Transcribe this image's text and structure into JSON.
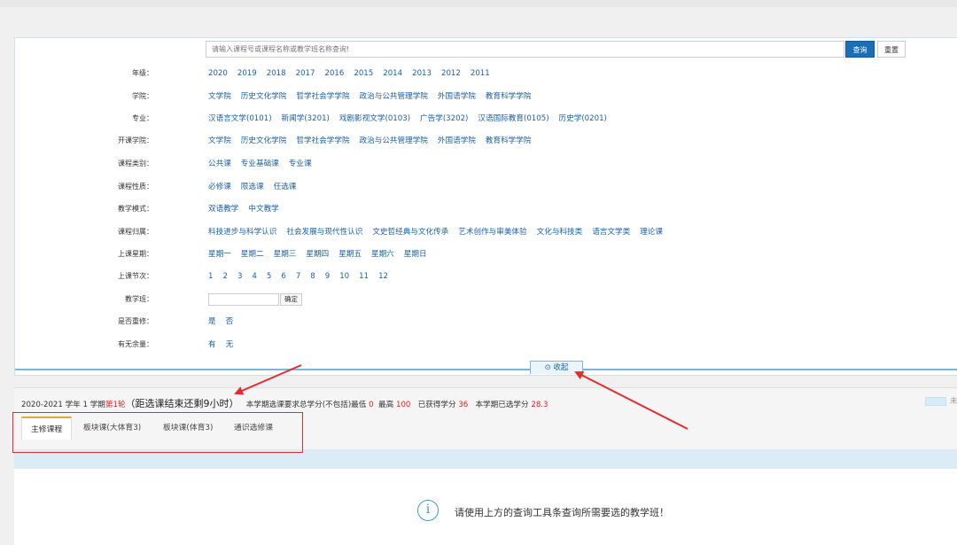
{
  "search": {
    "placeholder": "请输入课程号或课程名称或教学班名称查询!",
    "query_label": "查询",
    "reset_label": "重置"
  },
  "filters": [
    {
      "label": "年级：",
      "options": [
        "2020",
        "2019",
        "2018",
        "2017",
        "2016",
        "2015",
        "2014",
        "2013",
        "2012",
        "2011"
      ]
    },
    {
      "label": "学院：",
      "options": [
        "文学院",
        "历史文化学院",
        "哲学社会学学院",
        "政治与公共管理学院",
        "外国语学院",
        "教育科学学院"
      ]
    },
    {
      "label": "专业：",
      "options": [
        "汉语言文学(0101)",
        "新闻学(3201)",
        "戏剧影视文学(0103)",
        "广告学(3202)",
        "汉语国际教育(0105)",
        "历史学(0201)"
      ]
    },
    {
      "label": "开课学院：",
      "options": [
        "文学院",
        "历史文化学院",
        "哲学社会学学院",
        "政治与公共管理学院",
        "外国语学院",
        "教育科学学院"
      ]
    },
    {
      "label": "课程类别：",
      "options": [
        "公共课",
        "专业基础课",
        "专业课"
      ]
    },
    {
      "label": "课程性质：",
      "options": [
        "必修课",
        "限选课",
        "任选课"
      ]
    },
    {
      "label": "教学模式：",
      "options": [
        "双语教学",
        "中文教学"
      ]
    },
    {
      "label": "课程归属：",
      "options": [
        "科技进步与科学认识",
        "社会发展与现代性认识",
        "文史哲经典与文化传承",
        "艺术创作与审美体验",
        "文化与科技类",
        "语言文学类",
        "理论课"
      ]
    },
    {
      "label": "上课星期：",
      "options": [
        "星期一",
        "星期二",
        "星期三",
        "星期四",
        "星期五",
        "星期六",
        "星期日"
      ]
    },
    {
      "label": "上课节次：",
      "options": [
        "1",
        "2",
        "3",
        "4",
        "5",
        "6",
        "7",
        "8",
        "9",
        "10",
        "11",
        "12"
      ]
    },
    {
      "label": "教学班：",
      "input": true,
      "button": "确定"
    },
    {
      "label": "是否重修：",
      "options": [
        "是",
        "否"
      ]
    },
    {
      "label": "有无余量：",
      "options": [
        "有",
        "无"
      ]
    }
  ],
  "collapse_label": "收起",
  "status": {
    "year_term": "2020-2021 学年 1 学期",
    "round": "第1轮",
    "countdown": "（距选课结束还剩9小时）",
    "credits_text": "本学期选课要求总学分(不包括)最低",
    "min_credit": "0",
    "max_label": "最高",
    "max_credit": "100",
    "earned_label": "已获得学分",
    "earned_credit": "36",
    "selected_label": "本学期已选学分",
    "selected_credit": "28.3",
    "legend_label": "未"
  },
  "tabs": [
    "主修课程",
    "板块课(大体育3)",
    "板块课(体育3)",
    "通识选修课"
  ],
  "empty_message": "请使用上方的查询工具条查询所需要选的教学班！",
  "colors": {
    "primary": "#1a6fb8",
    "link": "#1a5fa8",
    "highlight": "#e02020",
    "annotation": "#e52b2b",
    "tab_accent": "#e8a63a"
  }
}
